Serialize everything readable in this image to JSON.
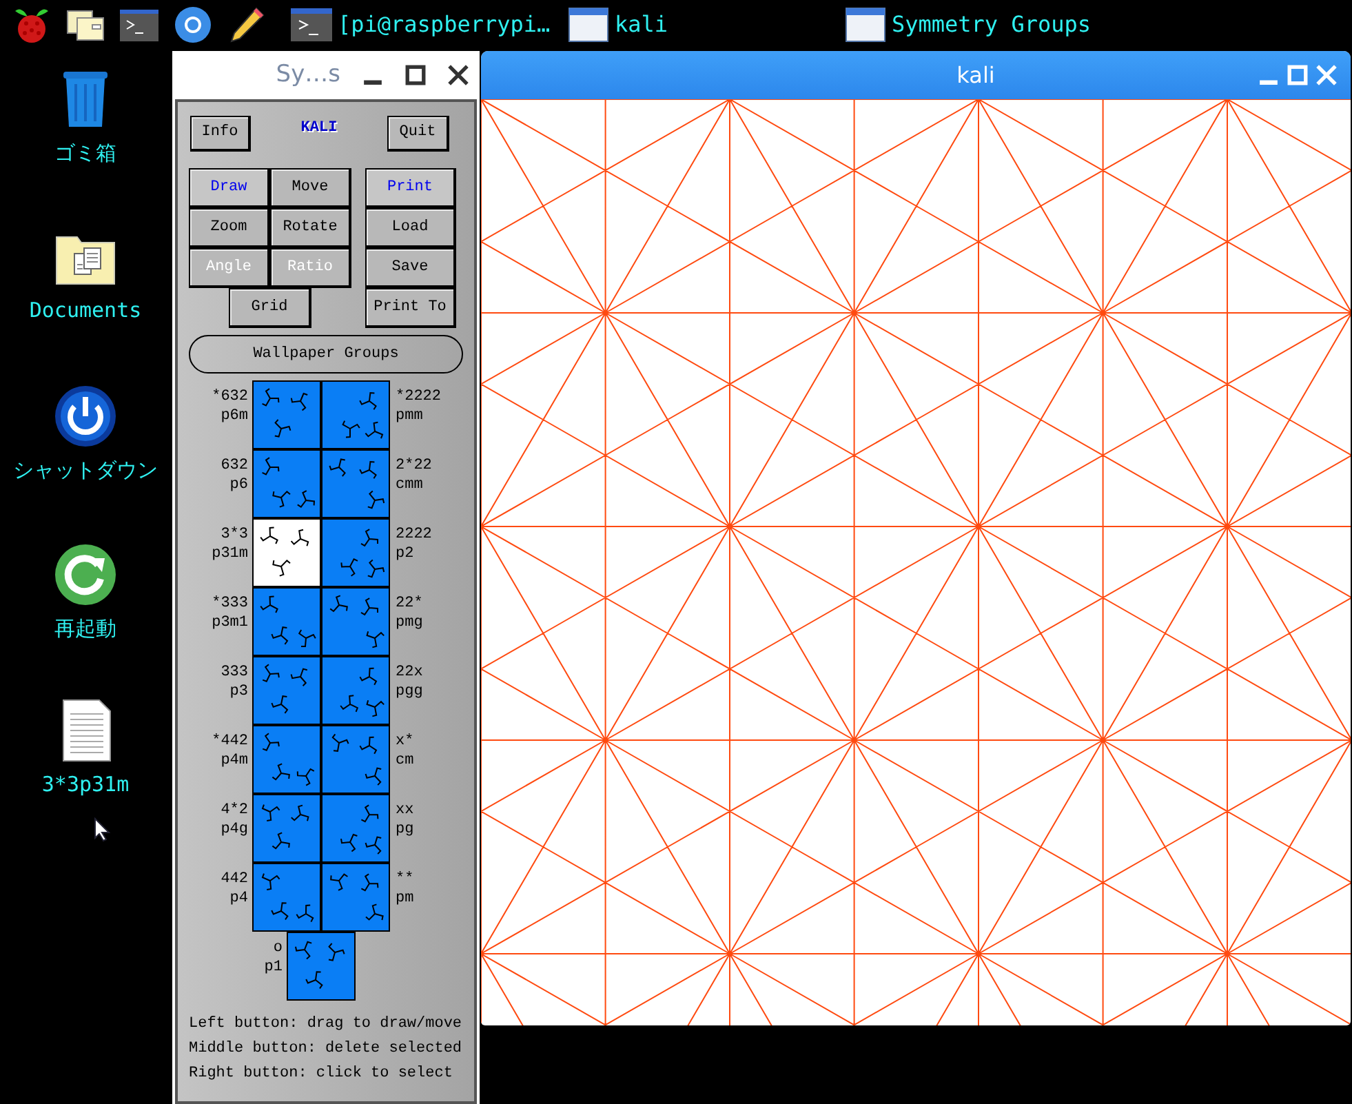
{
  "taskbar": {
    "tasks": [
      {
        "kind": "terminal",
        "title": "[pi@raspberrypi…"
      },
      {
        "kind": "window",
        "title": "kali"
      },
      {
        "kind": "window",
        "title": "Symmetry Groups"
      }
    ]
  },
  "desktop_icons": [
    {
      "kind": "trash",
      "label": "ゴミ箱"
    },
    {
      "kind": "folder",
      "label": "Documents"
    },
    {
      "kind": "shutdown",
      "label": "シャットダウン"
    },
    {
      "kind": "restart",
      "label": "再起動"
    },
    {
      "kind": "file",
      "label": "3*3p31m"
    }
  ],
  "control_window": {
    "title": "Sy…s",
    "info_button": "Info",
    "logo": "KALI",
    "quit_button": "Quit",
    "tool_buttons": [
      {
        "label": "Draw",
        "selected": true,
        "disabled": false
      },
      {
        "label": "Move",
        "selected": false,
        "disabled": false
      },
      {
        "label": "Zoom",
        "selected": false,
        "disabled": false
      },
      {
        "label": "Rotate",
        "selected": false,
        "disabled": false
      },
      {
        "label": "Angle",
        "selected": false,
        "disabled": true
      },
      {
        "label": "Ratio",
        "selected": false,
        "disabled": true
      },
      {
        "label": "Grid",
        "selected": false,
        "disabled": false
      }
    ],
    "file_buttons": [
      {
        "label": "Print",
        "selected": true
      },
      {
        "label": "Load",
        "selected": false
      },
      {
        "label": "Save",
        "selected": false
      },
      {
        "label": "Print To",
        "selected": false
      }
    ],
    "wallpaper_button": "Wallpaper Groups",
    "group_rows": [
      [
        {
          "orbifold": "*632",
          "name": "p6m",
          "selected": false
        },
        {
          "orbifold": "*2222",
          "name": "pmm",
          "selected": false
        }
      ],
      [
        {
          "orbifold": "632",
          "name": "p6",
          "selected": false
        },
        {
          "orbifold": "2*22",
          "name": "cmm",
          "selected": false
        }
      ],
      [
        {
          "orbifold": "3*3",
          "name": "p31m",
          "selected": true
        },
        {
          "orbifold": "2222",
          "name": "p2",
          "selected": false
        }
      ],
      [
        {
          "orbifold": "*333",
          "name": "p3m1",
          "selected": false
        },
        {
          "orbifold": "22*",
          "name": "pmg",
          "selected": false
        }
      ],
      [
        {
          "orbifold": "333",
          "name": "p3",
          "selected": false
        },
        {
          "orbifold": "22x",
          "name": "pgg",
          "selected": false
        }
      ],
      [
        {
          "orbifold": "*442",
          "name": "p4m",
          "selected": false
        },
        {
          "orbifold": "x*",
          "name": "cm",
          "selected": false
        }
      ],
      [
        {
          "orbifold": "4*2",
          "name": "p4g",
          "selected": false
        },
        {
          "orbifold": "xx",
          "name": "pg",
          "selected": false
        }
      ],
      [
        {
          "orbifold": "442",
          "name": "p4",
          "selected": false
        },
        {
          "orbifold": "**",
          "name": "pm",
          "selected": false
        }
      ],
      [
        {
          "orbifold": "o",
          "name": "p1",
          "selected": false
        }
      ]
    ],
    "help_lines": [
      "Left button: drag to draw/move",
      "Middle button: delete selected",
      "Right button: click to select"
    ]
  },
  "canvas_window": {
    "title": "kali"
  }
}
